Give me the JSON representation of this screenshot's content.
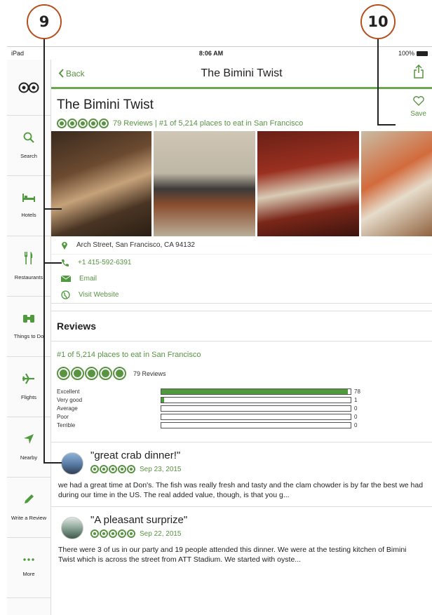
{
  "callouts": {
    "left": "9",
    "right": "10"
  },
  "status": {
    "device": "iPad",
    "time": "8:06 AM",
    "battery": "100%"
  },
  "sidebar": {
    "items": [
      {
        "label": "Search",
        "icon": "search-icon"
      },
      {
        "label": "Hotels",
        "icon": "bed-icon"
      },
      {
        "label": "Restaurants",
        "icon": "fork-knife-icon"
      },
      {
        "label": "Things to Do",
        "icon": "binoculars-icon"
      },
      {
        "label": "Flights",
        "icon": "airplane-icon"
      },
      {
        "label": "Nearby",
        "icon": "location-arrow-icon"
      },
      {
        "label": "Write a Review",
        "icon": "pencil-icon"
      },
      {
        "label": "More",
        "icon": "more-dots-icon"
      }
    ]
  },
  "nav": {
    "back": "Back",
    "title": "The Bimini Twist"
  },
  "header": {
    "name": "The Bimini Twist",
    "rating_text": "79 Reviews | #1 of 5,214 places to eat in San Francisco",
    "save": "Save",
    "rating": 5
  },
  "contact": {
    "address": "Arch Street, San Francisco, CA 94132",
    "phone": "+1 415-592-6391",
    "email": "Email",
    "website": "Visit Website"
  },
  "reviews": {
    "heading": "Reviews",
    "rank": "#1 of 5,214 places to eat in San Francisco",
    "count_label": "79 Reviews",
    "distribution": [
      {
        "label": "Excellent",
        "count": "78",
        "fraction": 0.987
      },
      {
        "label": "Very good",
        "count": "1",
        "fraction": 0.013
      },
      {
        "label": "Average",
        "count": "0",
        "fraction": 0
      },
      {
        "label": "Poor",
        "count": "0",
        "fraction": 0
      },
      {
        "label": "Terrible",
        "count": "0",
        "fraction": 0
      }
    ],
    "items": [
      {
        "title": "\"great crab dinner!\"",
        "date": "Sep 23, 2015",
        "text": "we had a great time at Don's. The fish was really fresh and tasty and the clam chowder is by far the best we had during our time in the US. The real added value, though, is that you g..."
      },
      {
        "title": "\"A pleasant surprize\"",
        "date": "Sep 22, 2015",
        "text": "There were 3 of us in our party and 19 people attended this dinner. We were at the testing kitchen of Bimini Twist which is across the street from ATT Stadium. We started with oyste..."
      }
    ]
  },
  "colors": {
    "accent": "#589442",
    "bar": "#4e9a3c",
    "callout_border": "#b5501e"
  }
}
